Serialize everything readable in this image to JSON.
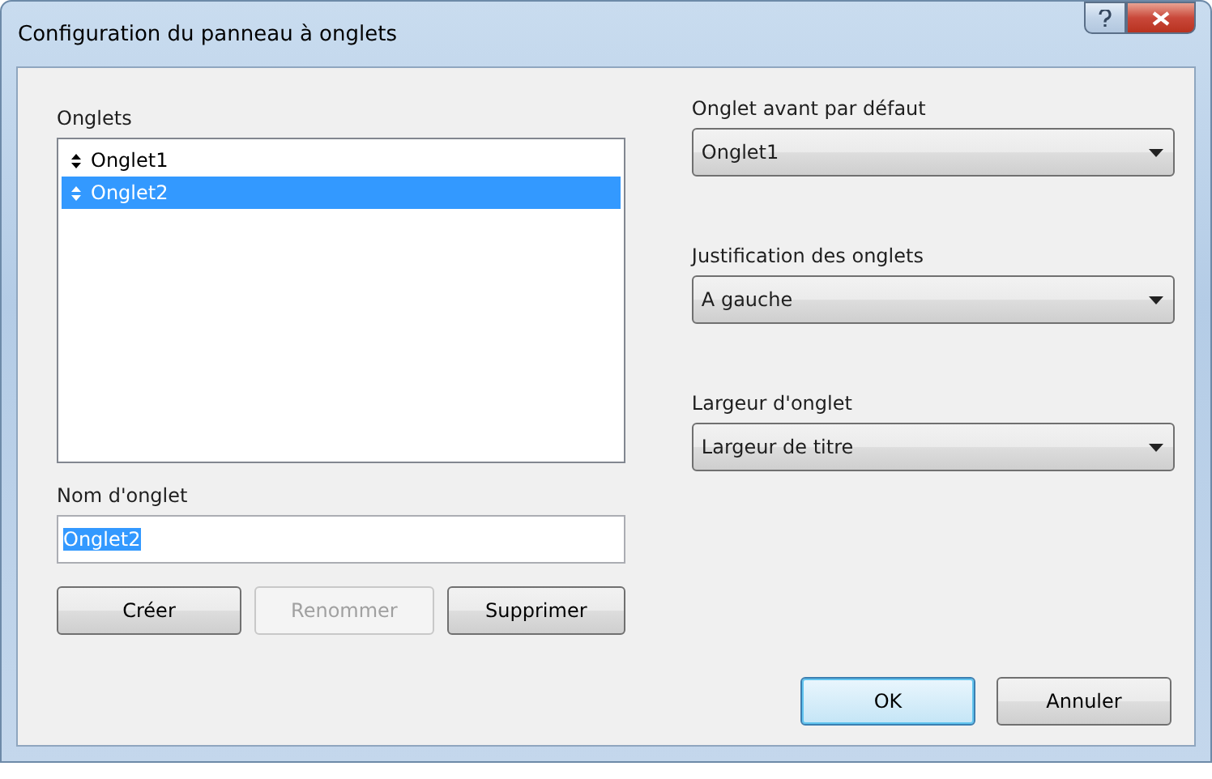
{
  "window": {
    "title": "Configuration du panneau à onglets"
  },
  "tab_list": {
    "label": "Onglets",
    "items": [
      {
        "label": "Onglet1",
        "selected": false
      },
      {
        "label": "Onglet2",
        "selected": true
      }
    ]
  },
  "name_field": {
    "label": "Nom d'onglet",
    "value": "Onglet2",
    "value_selected": true
  },
  "list_buttons": [
    {
      "label": "Créer",
      "disabled": false
    },
    {
      "label": "Renommer",
      "disabled": true
    },
    {
      "label": "Supprimer",
      "disabled": false
    }
  ],
  "dropdowns": [
    {
      "label": "Onglet avant par défaut",
      "value": "Onglet1"
    },
    {
      "label": "Justification des onglets",
      "value": "A gauche"
    },
    {
      "label": "Largeur d'onglet",
      "value": "Largeur de titre"
    }
  ],
  "footer_buttons": [
    {
      "label": "OK",
      "default": true
    },
    {
      "label": "Annuler",
      "default": false
    }
  ]
}
